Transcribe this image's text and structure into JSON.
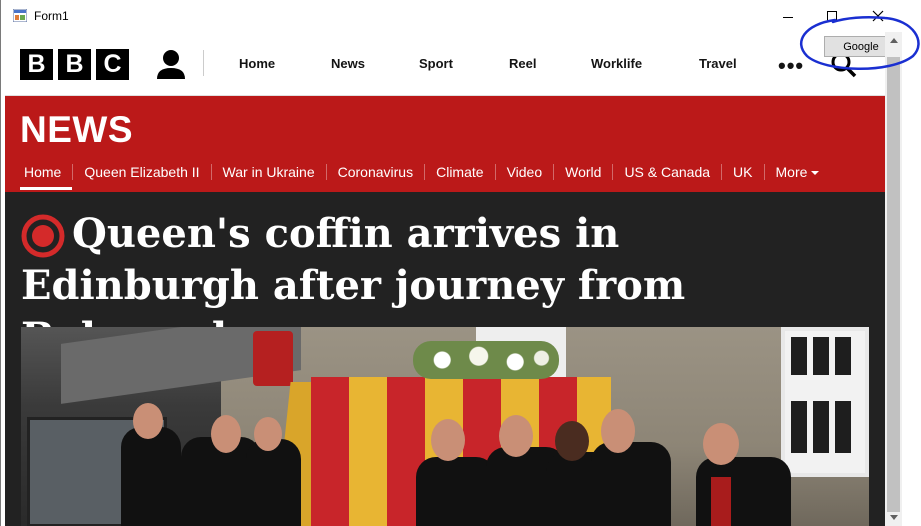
{
  "window": {
    "title": "Form1",
    "google_button_label": "Google"
  },
  "bbc": {
    "logo_letters": [
      "B",
      "B",
      "C"
    ],
    "nav_items": [
      "Home",
      "News",
      "Sport",
      "Reel",
      "Worklife",
      "Travel"
    ],
    "more_label": "•••"
  },
  "news": {
    "section_title": "NEWS",
    "subnav": [
      "Home",
      "Queen Elizabeth II",
      "War in Ukraine",
      "Coronavirus",
      "Climate",
      "Video",
      "World",
      "US & Canada",
      "UK",
      "More"
    ],
    "active_subnav": "Home"
  },
  "article": {
    "headline": "Queen's coffin arrives in Edinburgh after journey from Balmoral",
    "live_indicator_icon": "live-record-icon"
  },
  "colors": {
    "news_red": "#bb1919",
    "article_bg": "#222222",
    "annotation_blue": "#1a2fd1"
  }
}
